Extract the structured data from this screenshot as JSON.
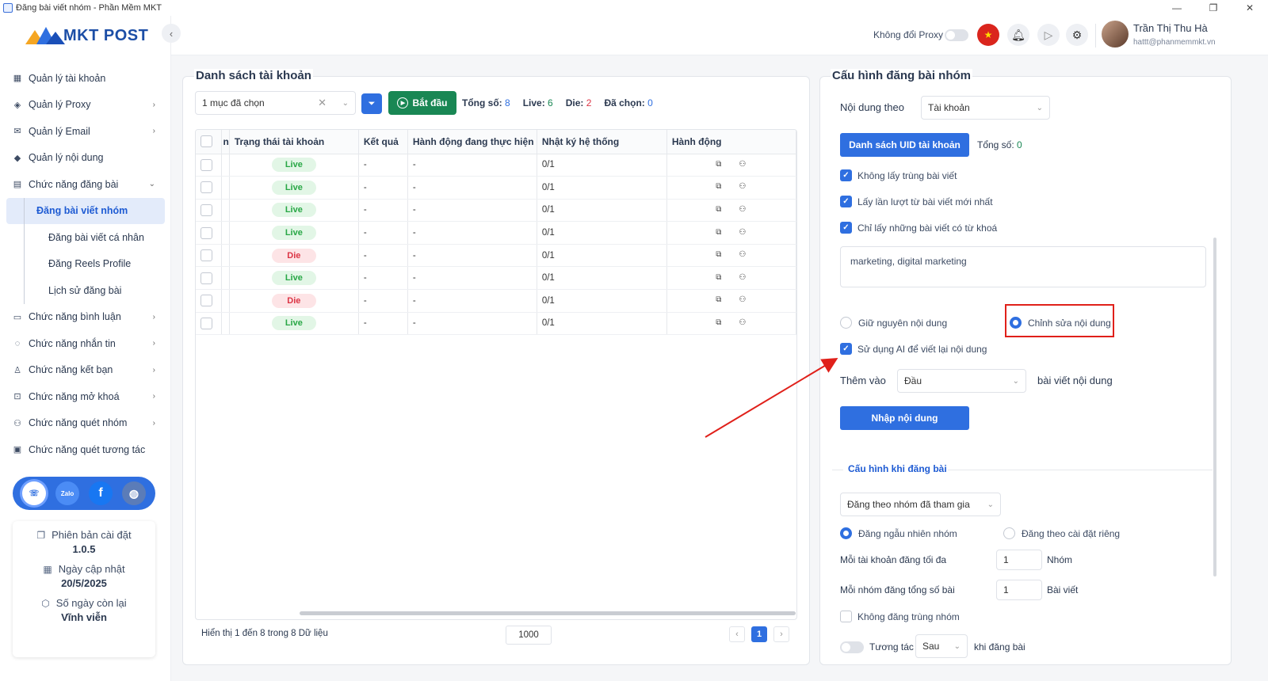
{
  "window": {
    "title": "Đăng bài viết nhóm - Phần Mềm MKT",
    "minimize": "—",
    "restore": "❐",
    "close": "✕"
  },
  "brand": {
    "name": "MKT POST"
  },
  "sidebar": {
    "items": [
      {
        "label": "Quản lý tài khoản",
        "icon": "grid-icon"
      },
      {
        "label": "Quản lý Proxy",
        "icon": "layers-icon",
        "chevron": "›"
      },
      {
        "label": "Quản lý Email",
        "icon": "mail-icon",
        "chevron": "›"
      },
      {
        "label": "Quản lý nội dung",
        "icon": "content-icon"
      },
      {
        "label": "Chức năng đăng bài",
        "icon": "post-icon",
        "chevron": "⌄"
      }
    ],
    "subitems": [
      {
        "label": "Đăng bài viết nhóm",
        "active": true
      },
      {
        "label": "Đăng bài viết cá nhân"
      },
      {
        "label": "Đăng Reels Profile"
      },
      {
        "label": "Lịch sử đăng bài"
      }
    ],
    "items2": [
      {
        "label": "Chức năng bình luận",
        "icon": "comment-icon",
        "chevron": "›"
      },
      {
        "label": "Chức năng nhắn tin",
        "icon": "chat-icon",
        "chevron": "›"
      },
      {
        "label": "Chức năng kết bạn",
        "icon": "add-friend-icon",
        "chevron": "›"
      },
      {
        "label": "Chức năng mở khoá",
        "icon": "unlock-icon",
        "chevron": "›"
      },
      {
        "label": "Chức năng quét nhóm",
        "icon": "group-icon",
        "chevron": "›"
      },
      {
        "label": "Chức năng quét tương tác",
        "icon": "scan-icon"
      }
    ]
  },
  "social": {
    "zalo": "Zalo",
    "facebook": "f"
  },
  "info": {
    "version_label": "Phiên bản cài đặt",
    "version": "1.0.5",
    "update_label": "Ngày cập nhật",
    "update": "20/5/2025",
    "days_label": "Số ngày còn lại",
    "days": "Vĩnh viễn"
  },
  "header": {
    "proxy_label": "Không đổi Proxy",
    "user_name": "Trần Thị Thu Hà",
    "user_email": "hattt@phanmemmkt.vn"
  },
  "accounts": {
    "title": "Danh sách tài khoản",
    "select_value": "1 mục đã chọn",
    "start_label": "Bắt đầu",
    "total_label": "Tổng số:",
    "total": "8",
    "live_label": "Live:",
    "live": "6",
    "die_label": "Die:",
    "die": "2",
    "selected_label": "Đã chọn:",
    "selected": "0",
    "columns": [
      "n",
      "Trạng thái tài khoản",
      "Kết quả",
      "Hành động đang thực hiện",
      "Nhật ký hệ thống",
      "Hành động"
    ],
    "rows": [
      {
        "status": "Live",
        "result": "-",
        "action": "-",
        "log": "0/1"
      },
      {
        "status": "Live",
        "result": "-",
        "action": "-",
        "log": "0/1"
      },
      {
        "status": "Live",
        "result": "-",
        "action": "-",
        "log": "0/1"
      },
      {
        "status": "Live",
        "result": "-",
        "action": "-",
        "log": "0/1"
      },
      {
        "status": "Die",
        "result": "-",
        "action": "-",
        "log": "0/1"
      },
      {
        "status": "Live",
        "result": "-",
        "action": "-",
        "log": "0/1"
      },
      {
        "status": "Die",
        "result": "-",
        "action": "-",
        "log": "0/1"
      },
      {
        "status": "Live",
        "result": "-",
        "action": "-",
        "log": "0/1"
      }
    ],
    "footer_text": "Hiển thị 1 đến 8 trong 8 Dữ liệu",
    "page_size": "1000",
    "page_current": "1",
    "page_prev": "‹",
    "page_next": "›"
  },
  "config": {
    "title": "Cấu hình đăng bài nhóm",
    "content_by_label": "Nội dung theo",
    "content_by_value": "Tài khoản",
    "uid_button": "Danh sách UID tài khoản",
    "uid_total_label": "Tổng số:",
    "uid_total": "0",
    "check1": "Không lấy trùng bài viết",
    "check2": "Lấy lần lượt từ bài viết mới nhất",
    "check3": "Chỉ lấy những bài viết có từ khoá",
    "keywords": "marketing, digital marketing",
    "radio_keep": "Giữ nguyên nội dung",
    "radio_edit": "Chỉnh sửa nội dung",
    "check_ai": "Sử dụng AI để viết lại nội dung",
    "add_label": "Thêm vào",
    "add_value": "Đầu",
    "add_suffix": "bài viết nội dung",
    "import_button": "Nhập nội dung",
    "section_title": "Cấu hình khi đăng bài",
    "group_mode": "Đăng theo nhóm đã tham gia",
    "radio_random": "Đăng ngẫu nhiên nhóm",
    "radio_custom": "Đăng theo cài đặt riêng",
    "max_label": "Mỗi tài khoản đăng tối đa",
    "max_value": "1",
    "max_unit": "Nhóm",
    "total_label": "Mỗi nhóm đăng tổng số bài",
    "total_value": "1",
    "total_unit": "Bài viết",
    "no_dup_group": "Không đăng trùng nhóm",
    "interact_label": "Tương tác",
    "interact_value": "Sau",
    "interact_suffix": "khi đăng bài"
  },
  "colors": {
    "primary": "#2f6fe0",
    "success": "#198754",
    "danger": "#dc3545",
    "annotation": "#e0201a"
  }
}
